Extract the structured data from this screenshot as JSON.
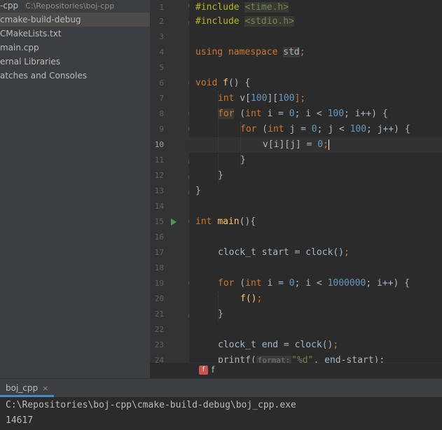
{
  "project_tree": {
    "root": {
      "name": "-cpp",
      "path": "C:\\Repositories\\boj-cpp"
    },
    "items": [
      {
        "label": "cmake-build-debug",
        "selected": true
      },
      {
        "label": "CMakeLists.txt",
        "selected": false
      },
      {
        "label": "main.cpp",
        "selected": false
      },
      {
        "label": "ernal Libraries",
        "selected": false
      },
      {
        "label": "atches and Consoles",
        "selected": false
      }
    ]
  },
  "editor": {
    "current_line": 10,
    "line_numbers": [
      "1",
      "2",
      "3",
      "4",
      "5",
      "6",
      "7",
      "8",
      "9",
      "10",
      "11",
      "12",
      "13",
      "14",
      "15",
      "16",
      "17",
      "18",
      "19",
      "20",
      "21",
      "22",
      "23",
      "24"
    ],
    "lines": {
      "l1_kw": "#include",
      "l1_hdr": "<time.h>",
      "l2_kw": "#include",
      "l2_hdr": "<stdio.h>",
      "l4_using": "using",
      "l4_namespace": "namespace",
      "l4_std": "std",
      "l4_semi": ";",
      "l6_void": "void",
      "l6_fn": "f",
      "l6_rest": "() {",
      "l7_int": "int",
      "l7_a": " v[",
      "l7_n1": "100",
      "l7_b": "][",
      "l7_n2": "100",
      "l7_c": "];",
      "l8_for": "for",
      "l8_a": " (",
      "l8_int": "int",
      "l8_b": " i = ",
      "l8_n0": "0",
      "l8_c": "; i < ",
      "l8_n100": "100",
      "l8_d": "; i++) {",
      "l9_for": "for",
      "l9_a": " (",
      "l9_int": "int",
      "l9_b": " j = ",
      "l9_n0": "0",
      "l9_c": "; j < ",
      "l9_n100": "100",
      "l9_d": "; j++) {",
      "l10_a": "v[i][j] = ",
      "l10_n0": "0",
      "l10_b": ";",
      "l11": "}",
      "l12": "}",
      "l13": "}",
      "l15_int": "int",
      "l15_fn": "main",
      "l15_rest": "(){",
      "l17_a": "clock_t start = clock()",
      "l17_b": ";",
      "l19_for": "for",
      "l19_a": " (",
      "l19_int": "int",
      "l19_b": " i = ",
      "l19_n0": "0",
      "l19_c": "; i < ",
      "l19_nbig": "1000000",
      "l19_d": "; i++) {",
      "l20_a": "f()",
      "l20_b": ";",
      "l21": "}",
      "l23_a": "clock_t end = clock()",
      "l23_b": ";",
      "l24_a": "printf(",
      "l24_hint": "format:",
      "l24_str": "\"%d\"",
      "l24_b": ", end-start);"
    }
  },
  "breadcrumb": {
    "badge": "f",
    "label": "f"
  },
  "run_window": {
    "tab_label": "boj_cpp",
    "close_glyph": "×",
    "output": [
      "C:\\Repositories\\boj-cpp\\cmake-build-debug\\boj_cpp.exe",
      "14617"
    ]
  },
  "colors": {
    "keyword": "#cc7832",
    "number": "#6897bb",
    "function": "#ffc66d",
    "string": "#6a8759",
    "preprocessor": "#bbb529",
    "run_icon": "#499c54"
  }
}
